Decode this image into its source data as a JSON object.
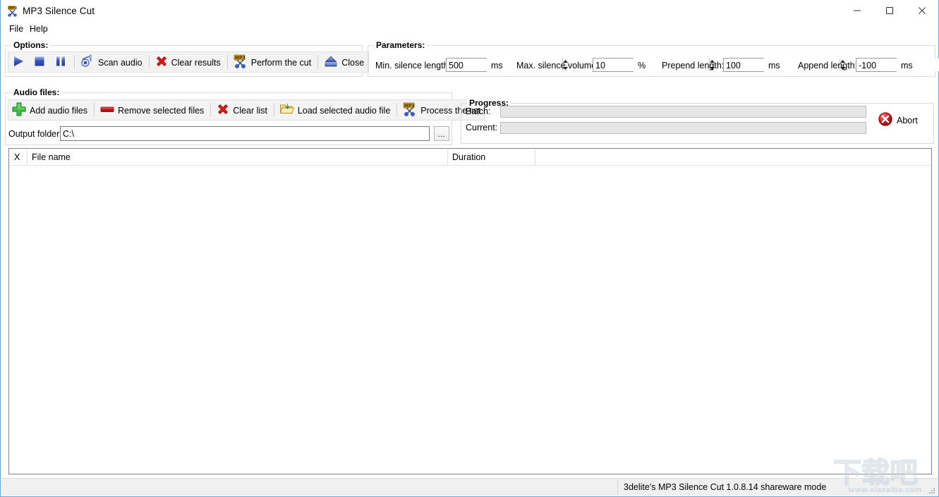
{
  "window": {
    "title": "MP3 Silence Cut",
    "icon": "mp3-scissors-icon",
    "controls": {
      "minimize": "minimize-button",
      "maximize": "maximize-button",
      "close": "close-button"
    },
    "border_color": "#6ba3d6"
  },
  "menu": {
    "items": [
      {
        "label": "File"
      },
      {
        "label": "Help"
      }
    ]
  },
  "options_group": {
    "label": "Options:",
    "buttons": [
      {
        "label": "",
        "icon": "play-icon"
      },
      {
        "label": "",
        "icon": "stop-icon"
      },
      {
        "label": "",
        "icon": "pause-icon"
      },
      {
        "label": "Scan audio",
        "icon": "scan-audio-icon"
      },
      {
        "label": "Clear results",
        "icon": "red-x-icon"
      },
      {
        "label": "Perform the cut",
        "icon": "mp3-scissors-icon"
      },
      {
        "label": "Close",
        "icon": "eject-icon"
      }
    ]
  },
  "parameters_group": {
    "label": "Parameters:",
    "fields": [
      {
        "label": "Min. silence length:",
        "value": "500",
        "unit": "ms"
      },
      {
        "label": "Max. silence volume:",
        "value": "10",
        "unit": "%"
      },
      {
        "label": "Prepend length:",
        "value": "100",
        "unit": "ms"
      },
      {
        "label": "Append length:",
        "value": "-100",
        "unit": "ms"
      }
    ]
  },
  "audio_files_group": {
    "label": "Audio files:",
    "buttons": [
      {
        "label": "Add audio files",
        "icon": "green-plus-icon"
      },
      {
        "label": "Remove selected files",
        "icon": "red-minus-icon"
      },
      {
        "label": "Clear list",
        "icon": "red-x-icon"
      },
      {
        "label": "Load selected audio file",
        "icon": "folder-open-icon"
      },
      {
        "label": "Process the list",
        "icon": "mp3-scissors-icon"
      }
    ],
    "output_folder": {
      "label": "Output folder:",
      "value": "C:\\",
      "placeholder": "",
      "browse_label": "..."
    }
  },
  "progress_group": {
    "label": "Progress:",
    "batch": {
      "label": "Batch:",
      "percent": 0
    },
    "current": {
      "label": "Current:",
      "percent": 0
    },
    "abort": {
      "label": "Abort",
      "icon": "red-x-circle-icon"
    }
  },
  "file_list": {
    "columns": [
      {
        "label": "X"
      },
      {
        "label": "File name"
      },
      {
        "label": "Duration"
      },
      {
        "label": ""
      }
    ],
    "rows": []
  },
  "statusbar": {
    "text": "3delite's MP3 Silence Cut 1.0.8.14 shareware mode"
  },
  "watermark": {
    "text_cn": "下载吧",
    "url": "www.xiazaiba.com"
  }
}
